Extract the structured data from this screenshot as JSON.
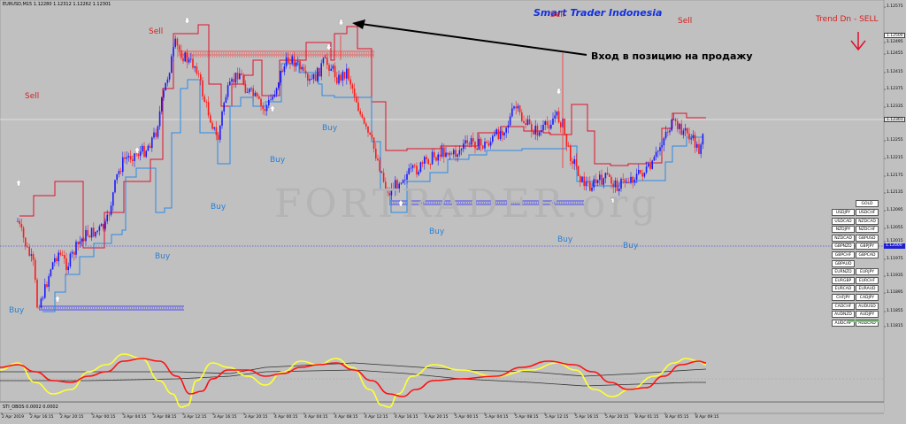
{
  "chart_header": "EURUSD,M15  1.12280 1.12312 1.12262 1.12301",
  "brand": "Smart Trader Indonesia",
  "trend_label": "Trend Dn - SELL",
  "annotation": "Вход в позицию на продажу",
  "watermark": "FORTRADER.org",
  "indicator_title": "STI_OBOS 0.0002 0.0002",
  "signals": [
    {
      "type": "sell",
      "label": "Sell"
    },
    {
      "type": "sell",
      "label": "Sell"
    },
    {
      "type": "sell",
      "label": "Sell"
    },
    {
      "type": "sell",
      "label": "Sell"
    },
    {
      "type": "buy",
      "label": "Buy"
    },
    {
      "type": "buy",
      "label": "Buy"
    },
    {
      "type": "buy",
      "label": "Buy"
    },
    {
      "type": "buy",
      "label": "Buy"
    },
    {
      "type": "buy",
      "label": "Buy"
    },
    {
      "type": "buy",
      "label": "Buy"
    },
    {
      "type": "buy",
      "label": "Buy"
    },
    {
      "type": "buy",
      "label": "Buy"
    }
  ],
  "price_scale": [
    "1.12575",
    "1.12495",
    "1.12455",
    "1.12415",
    "1.12375",
    "1.12335",
    "1.12255",
    "1.12215",
    "1.12175",
    "1.12135",
    "1.12095",
    "1.12055",
    "1.12015",
    "1.11975",
    "1.11935",
    "1.11895",
    "1.11855",
    "1.11815"
  ],
  "price_tags": {
    "current": "1.12301",
    "top": "1.12500",
    "dotted": "1.12000"
  },
  "currency_pairs": {
    "gold": "GOLD",
    "left": [
      "USDJPY",
      "USDCAD",
      "NZDJPY",
      "NZDCAD",
      "GBPNZD",
      "GBPCHF",
      "GBPAUD",
      "EURNZD",
      "EURGBP",
      "EURCAD",
      "CHFJPY",
      "CADCHF",
      "AUDNZD",
      "AUDCHF"
    ],
    "right": [
      "USDCHF",
      "NZDCAD",
      "NZDCHF",
      "GBPUSD",
      "GBPJPY",
      "GBPCAD",
      "",
      "EURJPY",
      "EURCHF",
      "EURAUD",
      "CADJPY",
      "AUDUSD",
      "AUDJPY",
      "AUDCAD"
    ]
  },
  "time_axis": [
    "2 Apr 2019",
    "2 Apr 16:15",
    "2 Apr 20:15",
    "3 Apr 00:15",
    "3 Apr 04:15",
    "3 Apr 08:15",
    "3 Apr 12:15",
    "3 Apr 16:15",
    "3 Apr 20:15",
    "4 Apr 00:15",
    "4 Apr 04:15",
    "4 Apr 08:15",
    "4 Apr 12:15",
    "4 Apr 16:15",
    "4 Apr 20:15",
    "5 Apr 00:15",
    "5 Apr 04:15",
    "5 Apr 08:15",
    "5 Apr 12:15",
    "5 Apr 16:15",
    "5 Apr 20:15",
    "8 Apr 01:15",
    "8 Apr 05:15",
    "8 Apr 09:15"
  ],
  "colors": {
    "background": "#c0c0c0",
    "bull_candle": "#1a1aff",
    "bear_candle": "#ff1a1a",
    "resistance": "#e0102a",
    "support": "#2a8ae8",
    "osc_fast": "#ffff33",
    "osc_slow": "#ff1010"
  }
}
